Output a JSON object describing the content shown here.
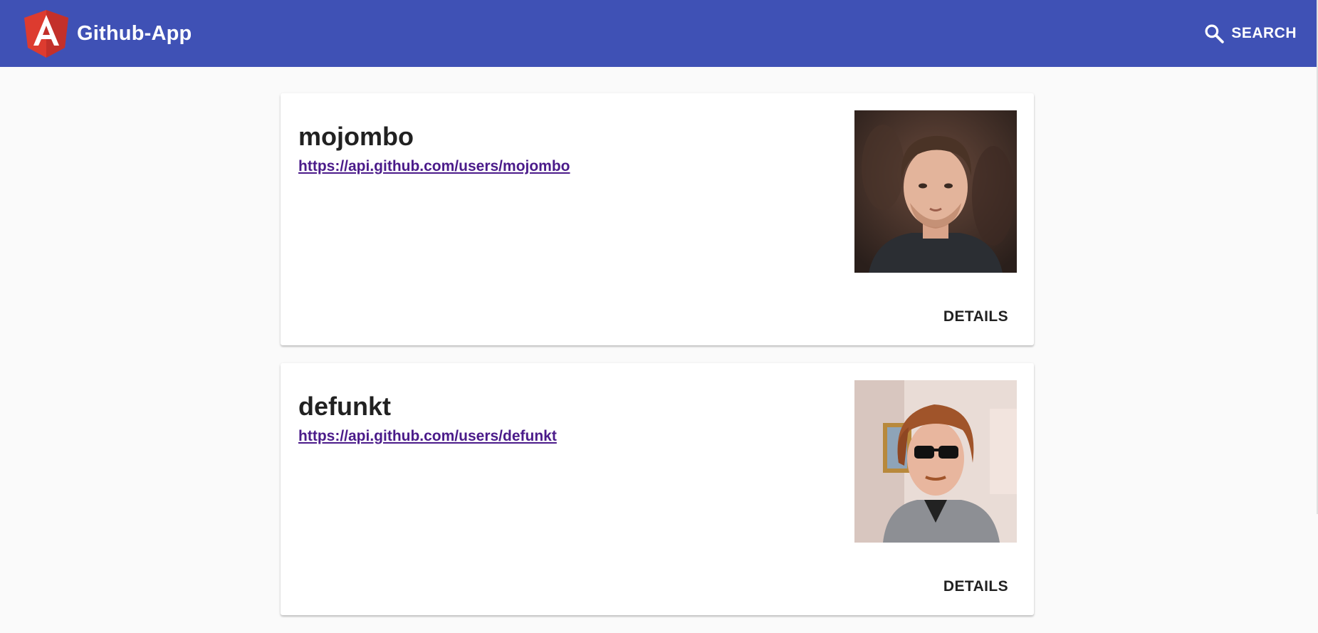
{
  "header": {
    "app_title": "Github-App",
    "search_label": "SEARCH",
    "logo_icon": "angular-logo-icon",
    "search_icon": "search-icon",
    "background_color": "#3f51b5"
  },
  "users": [
    {
      "login": "mojombo",
      "url": "https://api.github.com/users/mojombo",
      "details_label": "DETAILS"
    },
    {
      "login": "defunkt",
      "url": "https://api.github.com/users/defunkt",
      "details_label": "DETAILS"
    }
  ],
  "colors": {
    "link": "#4b1b8a",
    "page_background": "#fafafa"
  }
}
